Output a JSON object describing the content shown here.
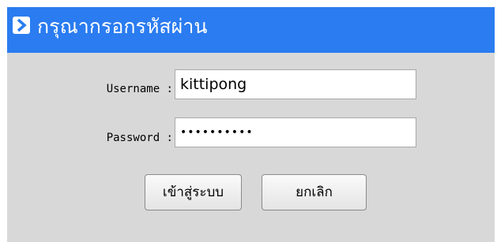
{
  "header": {
    "title": "กรุณากรอกรหัสผ่าน",
    "icon": "chevron-right-icon",
    "color": "#2a7cf0"
  },
  "form": {
    "username_label": "Username :",
    "username_value": "kittipong",
    "password_label": "Password :",
    "password_value": "••••••••••"
  },
  "buttons": {
    "login_label": "เข้าสู่ระบบ",
    "cancel_label": "ยกเลิก"
  }
}
